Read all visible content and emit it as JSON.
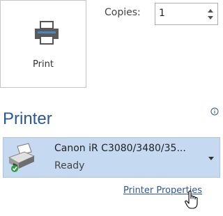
{
  "print": {
    "button_label": "Print",
    "icon": "printer-icon"
  },
  "copies": {
    "label": "Copies:",
    "value": "1",
    "spin_up_icon": "chevron-up-icon",
    "spin_down_icon": "chevron-down-icon"
  },
  "printer_section": {
    "title": "Printer",
    "info_icon": "info-icon",
    "selected_printer": {
      "name": "Canon iR C3080/3480/35...",
      "status": "Ready",
      "icon": "printer-icon"
    },
    "dropdown_icon": "chevron-down-icon",
    "properties_link": "Printer Properties"
  },
  "cursor": "hand-pointer-icon",
  "colors": {
    "section_title": "#2b579a",
    "link": "#2b579a",
    "selected_background": "#c5d9f1"
  }
}
